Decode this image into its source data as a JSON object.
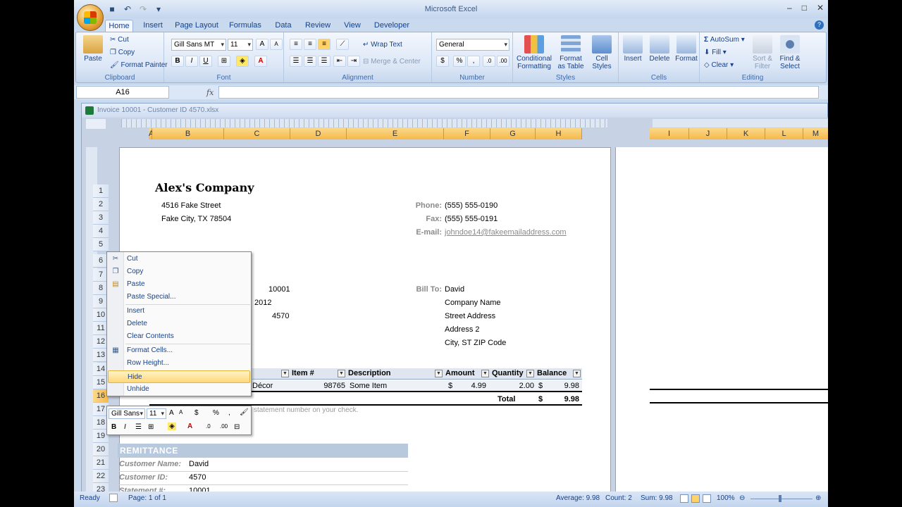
{
  "app": {
    "title": "Microsoft Excel"
  },
  "tabs": [
    "Home",
    "Insert",
    "Page Layout",
    "Formulas",
    "Data",
    "Review",
    "View",
    "Developer"
  ],
  "ribbon": {
    "clipboard": {
      "label": "Clipboard",
      "paste": "Paste",
      "cut": "Cut",
      "copy": "Copy",
      "format_painter": "Format Painter"
    },
    "font": {
      "label": "Font",
      "font_name": "Gill Sans MT",
      "font_size": "11"
    },
    "alignment": {
      "label": "Alignment",
      "wrap_text": "Wrap Text",
      "merge_center": "Merge & Center"
    },
    "number": {
      "label": "Number",
      "format": "General",
      "currency": "$",
      "percent": "%",
      "comma": ","
    },
    "styles": {
      "label": "Styles",
      "conditional": "Conditional Formatting",
      "format_table": "Format as Table",
      "cell_styles": "Cell Styles"
    },
    "cells": {
      "label": "Cells",
      "insert": "Insert",
      "delete": "Delete",
      "format": "Format"
    },
    "editing": {
      "label": "Editing",
      "autosum": "AutoSum",
      "fill": "Fill",
      "clear": "Clear",
      "sort_filter": "Sort & Filter",
      "find_select": "Find & Select"
    }
  },
  "formula_bar": {
    "name_box": "A16",
    "fx": "fx",
    "value": ""
  },
  "workbook": {
    "title": "Invoice 10001 - Customer ID 4570.xlsx"
  },
  "columns_left": [
    "A",
    "B",
    "C",
    "D",
    "E",
    "F",
    "G",
    "H"
  ],
  "columns_right": [
    "I",
    "J",
    "K",
    "L",
    "M"
  ],
  "rows": [
    "1",
    "2",
    "3",
    "4",
    "5",
    "6",
    "7",
    "8",
    "9",
    "10",
    "11",
    "12",
    "13",
    "14",
    "15",
    "16",
    "17",
    "18",
    "19",
    "20",
    "21",
    "22",
    "23"
  ],
  "company": {
    "name": "Alex's Company",
    "street": "4516 Fake Street",
    "city": "Fake City, TX 78504",
    "phone_label": "Phone:",
    "phone": "(555) 555-0190",
    "fax_label": "Fax:",
    "fax": "(555) 555-0191",
    "email_label": "E-mail:",
    "email": "johndoe14@fakeemailaddress.com"
  },
  "invoice": {
    "number": "10001",
    "date_partial": "2012",
    "customer_id": "4570"
  },
  "bill_to": {
    "label": "Bill To:",
    "name": "David",
    "company": "Company Name",
    "street": "Street Address",
    "address2": "Address 2",
    "city": "City, ST  ZIP Code"
  },
  "table": {
    "headers": [
      "Item #",
      "Description",
      "Amount",
      "Quantity",
      "Balance"
    ],
    "row": {
      "item_partial": "Décor",
      "item_no": "98765",
      "description": "Some Item",
      "amount_sym": "$",
      "amount": "4.99",
      "quantity": "2.00",
      "balance_sym": "$",
      "balance": "9.98"
    },
    "total_label": "Total",
    "total_sym": "$",
    "total": "9.98"
  },
  "note": "statement number on your check.",
  "remittance": {
    "header": "REMITTANCE",
    "customer_name_label": "Customer Name:",
    "customer_name": "David",
    "customer_id_label": "Customer ID:",
    "customer_id": "4570",
    "statement_label": "Statement #:",
    "statement": "10001"
  },
  "context_menu": [
    {
      "label": "Cut",
      "icon": "scissors-icon"
    },
    {
      "label": "Copy",
      "icon": "copy-icon"
    },
    {
      "label": "Paste",
      "icon": "paste-icon"
    },
    {
      "label": "Paste Special...",
      "icon": ""
    },
    {
      "label": "Insert",
      "icon": ""
    },
    {
      "label": "Delete",
      "icon": ""
    },
    {
      "label": "Clear Contents",
      "icon": ""
    },
    {
      "label": "Format Cells...",
      "icon": "format-cells-icon"
    },
    {
      "label": "Row Height...",
      "icon": ""
    },
    {
      "label": "Hide",
      "icon": ""
    },
    {
      "label": "Unhide",
      "icon": ""
    }
  ],
  "mini_toolbar": {
    "font": "Gill Sans",
    "size": "11"
  },
  "status": {
    "ready": "Ready",
    "page": "Page: 1 of 1",
    "average": "Average: 9.98",
    "count": "Count: 2",
    "sum": "Sum: 9.98",
    "zoom": "100%"
  }
}
